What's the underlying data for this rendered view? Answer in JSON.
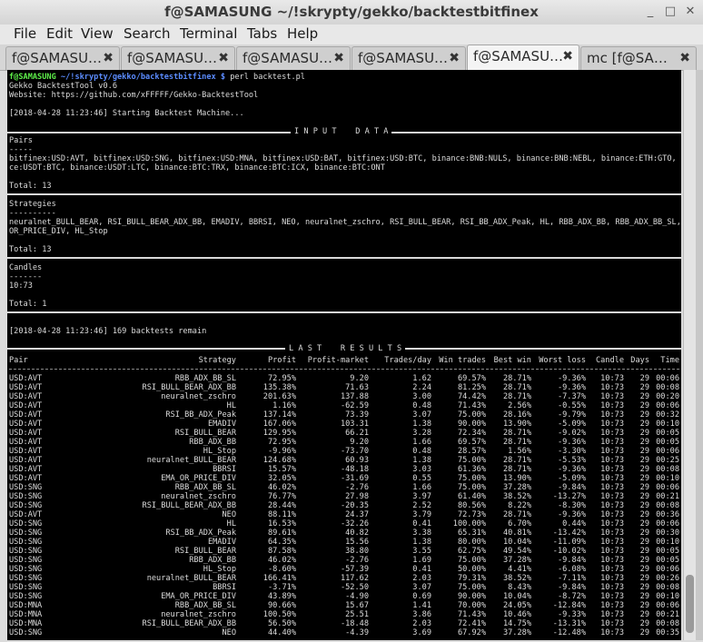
{
  "window": {
    "title": "f@SAMASUNG ~/!skrypty/gekko/backtestbitfinex",
    "minimize": "_",
    "maximize": "□",
    "close": "✕"
  },
  "menu": [
    "File",
    "Edit",
    "View",
    "Search",
    "Terminal",
    "Tabs",
    "Help"
  ],
  "tabs": [
    {
      "label": "f@SAMASU…",
      "close": "✖"
    },
    {
      "label": "f@SAMASU…",
      "close": "✖"
    },
    {
      "label": "f@SAMASU…",
      "close": "✖"
    },
    {
      "label": "f@SAMASU…",
      "close": "✖"
    },
    {
      "label": "f@SAMASU…",
      "close": "✖"
    },
    {
      "label": "mc [f@SA…",
      "close": "✖"
    }
  ],
  "terminal": {
    "prompt_user": "f@SAMASUNG",
    "prompt_path": " ~/!skrypty/gekko/backtestbitfinex $",
    "command": " perl backtest.pl",
    "lines": {
      "l1": "Gekko BacktestTool v0.6",
      "l2": "Website: https://github.com/xFFFFF/Gekko-BacktestTool",
      "l3": "[2018-04-28 11:23:46] Starting Backtest Machine...",
      "input_data": "I N P U T    D A T A",
      "pairs_h": "Pairs",
      "dash": "-----",
      "pairs_1": "bitfinex:USD:AVT, bitfinex:USD:SNG, bitfinex:USD:MNA, bitfinex:USD:BAT, bitfinex:USD:BTC, binance:BNB:NULS, binance:BNB:NEBL, binance:ETH:GTO, binan",
      "pairs_2": "ce:USDT:BTC, binance:USDT:LTC, binance:BTC:TRX, binance:BTC:ICX, binance:BTC:ONT",
      "total_pairs": "Total: 13",
      "strat_h": "Strategies",
      "dash2": "----------",
      "strat_1": "neuralnet_BULL_BEAR, RSI_BULL_BEAR_ADX_BB, EMADIV, BBRSI, NEO, neuralnet_zschro, RSI_BULL_BEAR, RSI_BB_ADX_Peak, HL, RBB_ADX_BB, RBB_ADX_BB_SL, EMA_",
      "strat_2": "OR_PRICE_DIV, HL_Stop",
      "total_strat": "Total: 13",
      "candles_h": "Candles",
      "dash3": "-------",
      "candles_v": "10:73",
      "total_candles": "Total: 1",
      "remain": "[2018-04-28 11:23:46] 169 backtests remain",
      "last_results": "L A S T    R E S U L T S"
    },
    "headers": [
      "Pair",
      "Strategy",
      "Profit",
      "Profit-market",
      "Trades/day",
      "Win trades",
      "Best win",
      "Worst loss",
      "Candle",
      "Days",
      "Time"
    ],
    "rows": [
      [
        "USD:AVT",
        "RBB_ADX_BB_SL",
        "72.95%",
        "9.20",
        "1.62",
        "69.57%",
        "28.71%",
        "-9.36%",
        "10:73",
        "29",
        "00:06"
      ],
      [
        "USD:AVT",
        "RSI_BULL_BEAR_ADX_BB",
        "135.38%",
        "71.63",
        "2.24",
        "81.25%",
        "28.71%",
        "-9.36%",
        "10:73",
        "29",
        "00:08"
      ],
      [
        "USD:AVT",
        "neuralnet_zschro",
        "201.63%",
        "137.88",
        "3.00",
        "74.42%",
        "28.71%",
        "-7.37%",
        "10:73",
        "29",
        "00:20"
      ],
      [
        "USD:AVT",
        "HL",
        "1.16%",
        "-62.59",
        "0.48",
        "71.43%",
        "2.56%",
        "-0.55%",
        "10:73",
        "29",
        "00:06"
      ],
      [
        "USD:AVT",
        "RSI_BB_ADX_Peak",
        "137.14%",
        "73.39",
        "3.07",
        "75.00%",
        "28.16%",
        "-9.79%",
        "10:73",
        "29",
        "00:32"
      ],
      [
        "USD:AVT",
        "EMADIV",
        "167.06%",
        "103.31",
        "1.38",
        "90.00%",
        "13.90%",
        "-5.09%",
        "10:73",
        "29",
        "00:10"
      ],
      [
        "USD:AVT",
        "RSI_BULL_BEAR",
        "129.95%",
        "66.21",
        "3.28",
        "72.34%",
        "28.71%",
        "-9.02%",
        "10:73",
        "29",
        "00:05"
      ],
      [
        "USD:AVT",
        "RBB_ADX_BB",
        "72.95%",
        "9.20",
        "1.66",
        "69.57%",
        "28.71%",
        "-9.36%",
        "10:73",
        "29",
        "00:05"
      ],
      [
        "USD:AVT",
        "HL_Stop",
        "-9.96%",
        "-73.70",
        "0.48",
        "28.57%",
        "1.56%",
        "-3.30%",
        "10:73",
        "29",
        "00:06"
      ],
      [
        "USD:AVT",
        "neuralnet_BULL_BEAR",
        "124.68%",
        "60.93",
        "1.38",
        "75.00%",
        "28.71%",
        "-5.53%",
        "10:73",
        "29",
        "00:25"
      ],
      [
        "USD:AVT",
        "BBRSI",
        "15.57%",
        "-48.18",
        "3.03",
        "61.36%",
        "28.71%",
        "-9.36%",
        "10:73",
        "29",
        "00:08"
      ],
      [
        "USD:AVT",
        "EMA_OR_PRICE_DIV",
        "32.05%",
        "-31.69",
        "0.55",
        "75.00%",
        "13.90%",
        "-5.09%",
        "10:73",
        "29",
        "00:10"
      ],
      [
        "USD:SNG",
        "RBB_ADX_BB_SL",
        "46.02%",
        "-2.76",
        "1.66",
        "75.00%",
        "37.28%",
        "-9.84%",
        "10:73",
        "29",
        "00:06"
      ],
      [
        "USD:SNG",
        "neuralnet_zschro",
        "76.77%",
        "27.98",
        "3.97",
        "61.40%",
        "38.52%",
        "-13.27%",
        "10:73",
        "29",
        "00:21"
      ],
      [
        "USD:SNG",
        "RSI_BULL_BEAR_ADX_BB",
        "28.44%",
        "-20.35",
        "2.52",
        "80.56%",
        "8.22%",
        "-8.30%",
        "10:73",
        "29",
        "00:08"
      ],
      [
        "USD:AVT",
        "NEO",
        "88.11%",
        "24.37",
        "3.79",
        "72.73%",
        "28.71%",
        "-9.36%",
        "10:73",
        "29",
        "00:36"
      ],
      [
        "USD:SNG",
        "HL",
        "16.53%",
        "-32.26",
        "0.41",
        "100.00%",
        "6.70%",
        "0.44%",
        "10:73",
        "29",
        "00:06"
      ],
      [
        "USD:SNG",
        "RSI_BB_ADX_Peak",
        "89.61%",
        "40.82",
        "3.38",
        "65.31%",
        "40.81%",
        "-13.42%",
        "10:73",
        "29",
        "00:30"
      ],
      [
        "USD:SNG",
        "EMADIV",
        "64.35%",
        "15.56",
        "1.38",
        "80.00%",
        "10.04%",
        "-11.09%",
        "10:73",
        "29",
        "00:10"
      ],
      [
        "USD:SNG",
        "RSI_BULL_BEAR",
        "87.58%",
        "38.80",
        "3.55",
        "62.75%",
        "49.54%",
        "-10.02%",
        "10:73",
        "29",
        "00:05"
      ],
      [
        "USD:SNG",
        "RBB_ADX_BB",
        "46.02%",
        "-2.76",
        "1.69",
        "75.00%",
        "37.28%",
        "-9.84%",
        "10:73",
        "29",
        "00:05"
      ],
      [
        "USD:SNG",
        "HL_Stop",
        "-8.60%",
        "-57.39",
        "0.41",
        "50.00%",
        "4.41%",
        "-6.08%",
        "10:73",
        "29",
        "00:06"
      ],
      [
        "USD:SNG",
        "neuralnet_BULL_BEAR",
        "166.41%",
        "117.62",
        "2.03",
        "79.31%",
        "38.52%",
        "-7.11%",
        "10:73",
        "29",
        "00:26"
      ],
      [
        "USD:SNG",
        "BBRSI",
        "-3.71%",
        "-52.50",
        "3.07",
        "75.00%",
        "8.43%",
        "-9.84%",
        "10:73",
        "29",
        "00:08"
      ],
      [
        "USD:SNG",
        "EMA_OR_PRICE_DIV",
        "43.89%",
        "-4.90",
        "0.69",
        "90.00%",
        "10.04%",
        "-8.72%",
        "10:73",
        "29",
        "00:10"
      ],
      [
        "USD:MNA",
        "RBB_ADX_BB_SL",
        "90.66%",
        "15.67",
        "1.41",
        "70.00%",
        "24.05%",
        "-12.84%",
        "10:73",
        "29",
        "00:06"
      ],
      [
        "USD:MNA",
        "neuralnet_zschro",
        "100.50%",
        "25.51",
        "3.86",
        "71.43%",
        "10.46%",
        "-9.33%",
        "10:73",
        "29",
        "00:21"
      ],
      [
        "USD:MNA",
        "RSI_BULL_BEAR_ADX_BB",
        "56.50%",
        "-18.48",
        "2.03",
        "72.41%",
        "14.75%",
        "-13.31%",
        "10:73",
        "29",
        "00:08"
      ],
      [
        "USD:SNG",
        "NEO",
        "44.40%",
        "-4.39",
        "3.69",
        "67.92%",
        "37.28%",
        "-12.48%",
        "10:73",
        "29",
        "00:35"
      ]
    ]
  }
}
